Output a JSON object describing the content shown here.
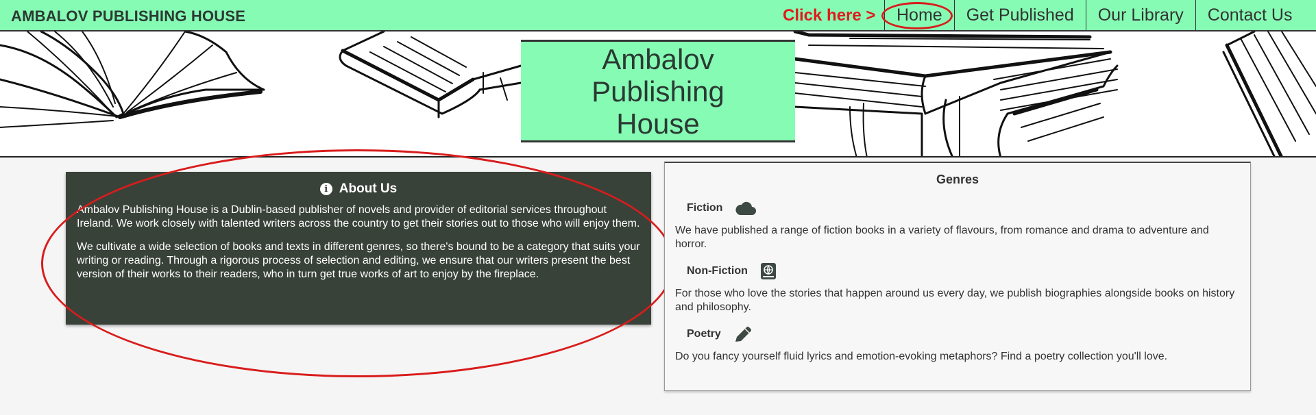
{
  "nav": {
    "brand": "AMBALOV PUBLISHING HOUSE",
    "annotation": "Click here >",
    "links": [
      {
        "label": "Home"
      },
      {
        "label": "Get Published"
      },
      {
        "label": "Our Library"
      },
      {
        "label": "Contact Us"
      }
    ]
  },
  "hero": {
    "title": "Ambalov Publishing House"
  },
  "about": {
    "icon": "info-icon",
    "title": "About Us",
    "paragraphs": [
      "Ambalov Publishing House is a Dublin-based publisher of novels and provider of editorial services throughout Ireland. We work closely with talented writers across the country to get their stories out to those who will enjoy them.",
      "We cultivate a wide selection of books and texts in different genres, so there's bound to be a category that suits your writing or reading. Through a rigorous process of selection and editing, we ensure that our writers present the best version of their works to their readers, who in turn get true works of art to enjoy by the fireplace."
    ]
  },
  "genres": {
    "title": "Genres",
    "items": [
      {
        "label": "Fiction",
        "icon": "cloud-icon",
        "text": "We have published a range of fiction books in a variety of flavours, from romance and drama to adventure and horror."
      },
      {
        "label": "Non-Fiction",
        "icon": "atlas-book-icon",
        "text": "For those who love the stories that happen around us every day, we publish biographies alongside books on history and philosophy."
      },
      {
        "label": "Poetry",
        "icon": "pencil-icon",
        "text": "Do you fancy yourself fluid lyrics and emotion-evoking metaphors? Find a poetry collection you'll love."
      }
    ]
  },
  "colors": {
    "nav_bg": "#86fbb4",
    "about_bg": "#394239",
    "annotation_red": "#d91c1c"
  }
}
